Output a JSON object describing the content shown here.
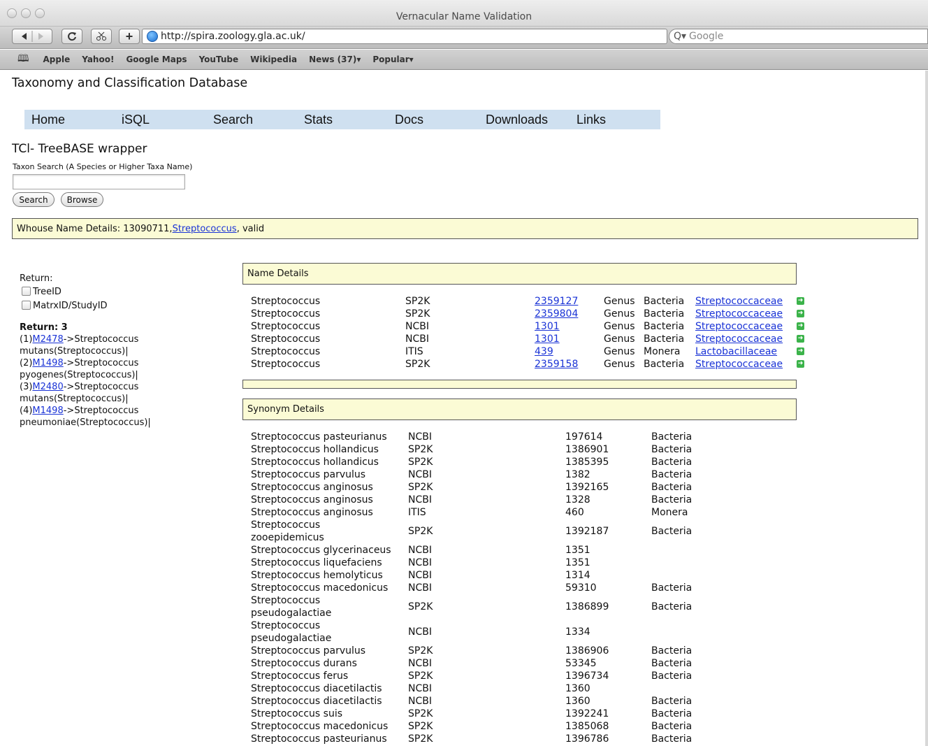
{
  "window": {
    "title": "Vernacular Name Validation"
  },
  "toolbar": {
    "url": "http://spira.zoology.gla.ac.uk/",
    "search_placeholder": "Google"
  },
  "bookmarks": [
    "Apple",
    "Yahoo!",
    "Google Maps",
    "YouTube",
    "Wikipedia",
    "News (37)▾",
    "Popular▾"
  ],
  "site": {
    "title": "Taxonomy and Classification Database"
  },
  "nav": [
    "Home",
    "iSQL",
    "Search",
    "Stats",
    "Docs",
    "Downloads",
    "Links"
  ],
  "tool": {
    "subtitle": "TCl- TreeBASE wrapper",
    "search_label": "Taxon Search (A Species or Higher Taxa Name)",
    "input_value": "",
    "search_button": "Search",
    "browse_button": "Browse"
  },
  "whouse": {
    "prefix": "Whouse Name Details: 13090711,",
    "link": "Streptococcus",
    "suffix": ", valid"
  },
  "left": {
    "return_label": "Return:",
    "options": [
      "TreeID",
      "MatrxID/StudyID"
    ],
    "return_count": "Return: 3",
    "results": [
      {
        "prefix": "(1)",
        "link": "M2478",
        "text": "->Streptococcus",
        "text2": "mutans(Streptococcus)|"
      },
      {
        "prefix": "(2)",
        "link": "M1498",
        "text": "->Streptococcus",
        "text2": "pyogenes(Streptococcus)|"
      },
      {
        "prefix": "(3)",
        "link": "M2480",
        "text": "->Streptococcus",
        "text2": "mutans(Streptococcus)|"
      },
      {
        "prefix": "(4)",
        "link": "M1498",
        "text": "->Streptococcus",
        "text2": "pneumoniae(Streptococcus)|"
      }
    ]
  },
  "name_details": {
    "header": "Name Details",
    "rows": [
      {
        "name": "Streptococcus",
        "src": "SP2K",
        "id": "2359127",
        "rank": "Genus",
        "kingdom": "Bacteria",
        "family": "Streptococcaceae"
      },
      {
        "name": "Streptococcus",
        "src": "SP2K",
        "id": "2359804",
        "rank": "Genus",
        "kingdom": "Bacteria",
        "family": "Streptococcaceae"
      },
      {
        "name": "Streptococcus",
        "src": "NCBI",
        "id": "1301",
        "rank": "Genus",
        "kingdom": "Bacteria",
        "family": "Streptococcaceae"
      },
      {
        "name": "Streptococcus",
        "src": "NCBI",
        "id": "1301",
        "rank": "Genus",
        "kingdom": "Bacteria",
        "family": "Streptococcaceae"
      },
      {
        "name": "Streptococcus",
        "src": "ITIS",
        "id": "439",
        "rank": "Genus",
        "kingdom": "Monera",
        "family": "Lactobacillaceae"
      },
      {
        "name": "Streptococcus",
        "src": "SP2K",
        "id": "2359158",
        "rank": "Genus",
        "kingdom": "Bacteria",
        "family": "Streptococcaceae"
      }
    ]
  },
  "synonym_details": {
    "header": "Synonym Details",
    "rows": [
      {
        "name": "Streptococcus pasteurianus",
        "src": "NCBI",
        "id": "197614",
        "kingdom": "Bacteria"
      },
      {
        "name": "Streptococcus hollandicus",
        "src": "SP2K",
        "id": "1386901",
        "kingdom": "Bacteria"
      },
      {
        "name": "Streptococcus hollandicus",
        "src": "SP2K",
        "id": "1385395",
        "kingdom": "Bacteria"
      },
      {
        "name": "Streptococcus parvulus",
        "src": "NCBI",
        "id": "1382",
        "kingdom": "Bacteria"
      },
      {
        "name": "Streptococcus anginosus",
        "src": "SP2K",
        "id": "1392165",
        "kingdom": "Bacteria"
      },
      {
        "name": "Streptococcus anginosus",
        "src": "NCBI",
        "id": "1328",
        "kingdom": "Bacteria"
      },
      {
        "name": "Streptococcus anginosus",
        "src": "ITIS",
        "id": "460",
        "kingdom": "Monera"
      },
      {
        "name": "Streptococcus",
        "name2": "zooepidemicus",
        "src": "SP2K",
        "id": "1392187",
        "kingdom": "Bacteria"
      },
      {
        "name": "Streptococcus glycerinaceus",
        "src": "NCBI",
        "id": "1351",
        "kingdom": ""
      },
      {
        "name": "Streptococcus liquefaciens",
        "src": "NCBI",
        "id": "1351",
        "kingdom": ""
      },
      {
        "name": "Streptococcus hemolyticus",
        "src": "NCBI",
        "id": "1314",
        "kingdom": ""
      },
      {
        "name": "Streptococcus macedonicus",
        "src": "NCBI",
        "id": "59310",
        "kingdom": "Bacteria"
      },
      {
        "name": "Streptococcus",
        "name2": "pseudogalactiae",
        "src": "SP2K",
        "id": "1386899",
        "kingdom": "Bacteria"
      },
      {
        "name": "Streptococcus",
        "name2": "pseudogalactiae",
        "src": "NCBI",
        "id": "1334",
        "kingdom": ""
      },
      {
        "name": "Streptococcus parvulus",
        "src": "SP2K",
        "id": "1386906",
        "kingdom": "Bacteria"
      },
      {
        "name": "Streptococcus durans",
        "src": "NCBI",
        "id": "53345",
        "kingdom": "Bacteria"
      },
      {
        "name": "Streptococcus ferus",
        "src": "SP2K",
        "id": "1396734",
        "kingdom": "Bacteria"
      },
      {
        "name": "Streptococcus diacetilactis",
        "src": "NCBI",
        "id": "1360",
        "kingdom": ""
      },
      {
        "name": "Streptococcus diacetilactis",
        "src": "NCBI",
        "id": "1360",
        "kingdom": "Bacteria"
      },
      {
        "name": "Streptococcus suis",
        "src": "SP2K",
        "id": "1392241",
        "kingdom": "Bacteria"
      },
      {
        "name": "Streptococcus macedonicus",
        "src": "SP2K",
        "id": "1385068",
        "kingdom": "Bacteria"
      },
      {
        "name": "Streptococcus pasteurianus",
        "src": "SP2K",
        "id": "1396786",
        "kingdom": "Bacteria"
      }
    ]
  }
}
